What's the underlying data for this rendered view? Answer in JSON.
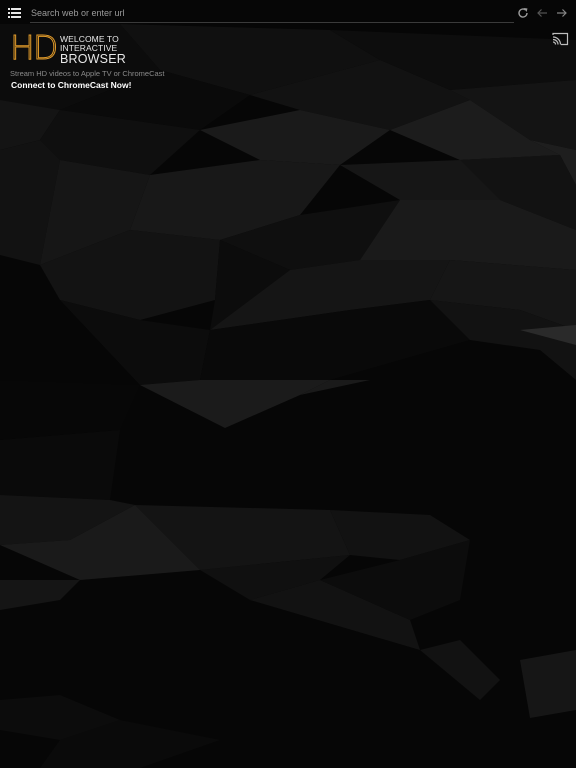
{
  "toolbar": {
    "menu_icon": "list-menu-icon",
    "url_placeholder": "Search web or enter url",
    "url_value": "",
    "reload_icon": "reload-icon",
    "back_icon": "arrow-left-icon",
    "forward_icon": "arrow-right-icon"
  },
  "cast": {
    "icon": "cast-icon"
  },
  "hero": {
    "logo_mark": "HD",
    "logo_line1": "WELCOME TO",
    "logo_line2": "INTERACTIVE",
    "logo_line3": "BROWSER",
    "tagline": "Stream HD videos to Apple TV or ChromeCast",
    "connect_label": "Connect to ChromeCast Now!"
  },
  "colors": {
    "background": "#060606",
    "logo_accent": "#e09a2a",
    "text_primary": "#ffffff",
    "text_muted": "#8a8a8a"
  }
}
